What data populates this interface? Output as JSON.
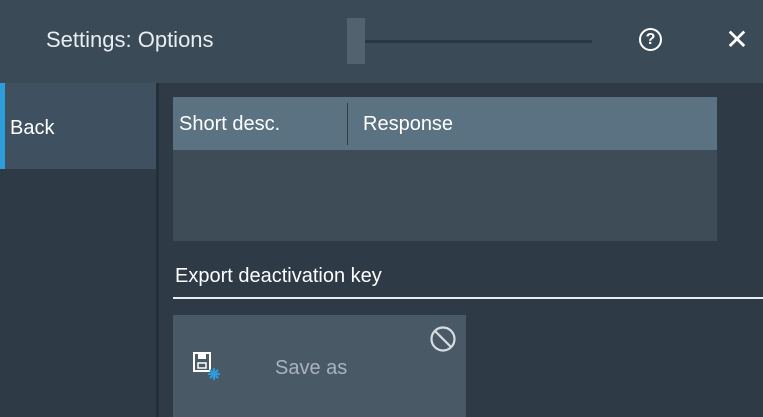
{
  "window": {
    "title": "Settings: Options",
    "help_glyph": "?",
    "close_glyph": "✕"
  },
  "sidebar": {
    "back_label": "Back"
  },
  "table": {
    "columns": [
      "Short desc.",
      "Response"
    ],
    "rows": []
  },
  "export": {
    "section_title": "Export deactivation key",
    "save_as_label": "Save as",
    "save_as_icon": "save-file-icon",
    "state_icon": "disabled-icon"
  },
  "colors": {
    "accent": "#2d9cdb",
    "titlebar": "#3b4a57",
    "table_header": "#5b7282"
  }
}
